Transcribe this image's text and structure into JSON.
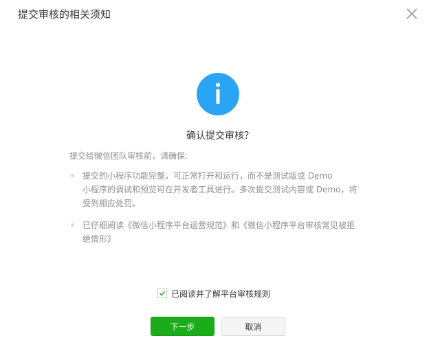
{
  "dialog": {
    "title": "提交审核的相关须知",
    "close_icon": "close-icon"
  },
  "main": {
    "info_icon": "info-icon",
    "info_icon_color": "#2aa4f4",
    "heading": "确认提交审核？",
    "intro": "提交给微信团队审核前，请确保:",
    "requirements": [
      {
        "line1": "提交的小程序功能完整，可正常打开和运行，而不是测试版或 Demo",
        "line2": "小程序的调试和预览可在开发者工具进行。多次提交测试内容或 Demo，将",
        "line3": "受到相应处罚。"
      },
      {
        "line1": "已仔细阅读《微信小程序平台运营规范》和《微信小程序平台审核常见被拒",
        "line2": "绝情形》"
      }
    ]
  },
  "agreement": {
    "checked": true,
    "label": "已阅读并了解平台审核规则"
  },
  "footer": {
    "next_label": "下一步",
    "cancel_label": "取消",
    "primary_color": "#1aad19"
  }
}
